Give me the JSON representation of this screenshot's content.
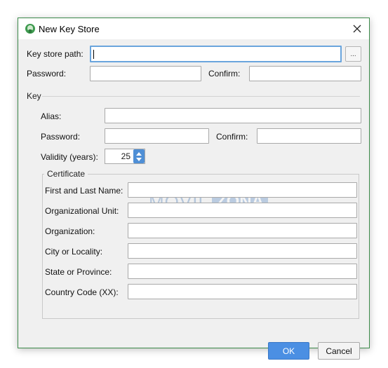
{
  "window": {
    "title": "New Key Store",
    "icon": "android-studio-icon",
    "border_color": "#3c8a4a"
  },
  "keystore": {
    "path_label": "Key store path:",
    "path_value": "",
    "browse_label": "...",
    "password_label": "Password:",
    "password_value": "",
    "confirm_label": "Confirm:",
    "confirm_value": ""
  },
  "key": {
    "section_label": "Key",
    "alias_label": "Alias:",
    "alias_value": "",
    "password_label": "Password:",
    "password_value": "",
    "confirm_label": "Confirm:",
    "confirm_value": "",
    "validity_label": "Validity (years):",
    "validity_value": "25"
  },
  "certificate": {
    "legend": "Certificate",
    "fields": [
      {
        "label": "First and Last Name:",
        "value": ""
      },
      {
        "label": "Organizational Unit:",
        "value": ""
      },
      {
        "label": "Organization:",
        "value": ""
      },
      {
        "label": "City or Locality:",
        "value": ""
      },
      {
        "label": "State or Province:",
        "value": ""
      },
      {
        "label": "Country Code (XX):",
        "value": ""
      }
    ]
  },
  "watermark": {
    "part1": "MOVIL",
    "part2": "ZONA"
  },
  "buttons": {
    "ok_label": "OK",
    "cancel_label": "Cancel",
    "ok_color": "#4b8fe3"
  }
}
